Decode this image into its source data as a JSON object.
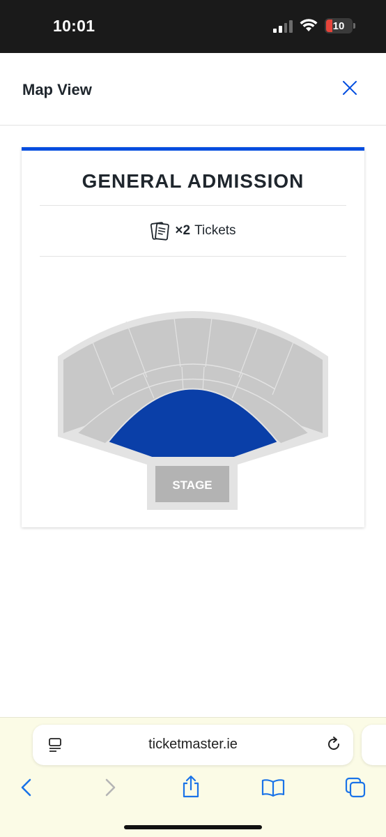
{
  "status_bar": {
    "time": "10:01",
    "battery": "10",
    "icons": [
      "signal-icon",
      "wifi-icon",
      "battery-icon"
    ]
  },
  "header": {
    "title": "Map View",
    "close_icon": "close-icon"
  },
  "card": {
    "title": "GENERAL ADMISSION",
    "tickets_quantity": "×2",
    "tickets_label": "Tickets",
    "ticket_icon": "ticket-icon"
  },
  "seatmap": {
    "stage_label": "STAGE",
    "colors": {
      "general_admission": "#0a3fa8",
      "seat_section": "#c8c8c8",
      "outline": "#e3e3e3",
      "stage": "#b3b3b3"
    }
  },
  "browser": {
    "url": "ticketmaster.ie",
    "icons": [
      "page-menu-icon",
      "reload-icon",
      "back-icon",
      "forward-icon",
      "share-icon",
      "bookmarks-icon",
      "tabs-icon"
    ]
  },
  "colors": {
    "accent": "#024ddf",
    "text": "#1f262d",
    "browser_bar": "#fbfbe6"
  }
}
